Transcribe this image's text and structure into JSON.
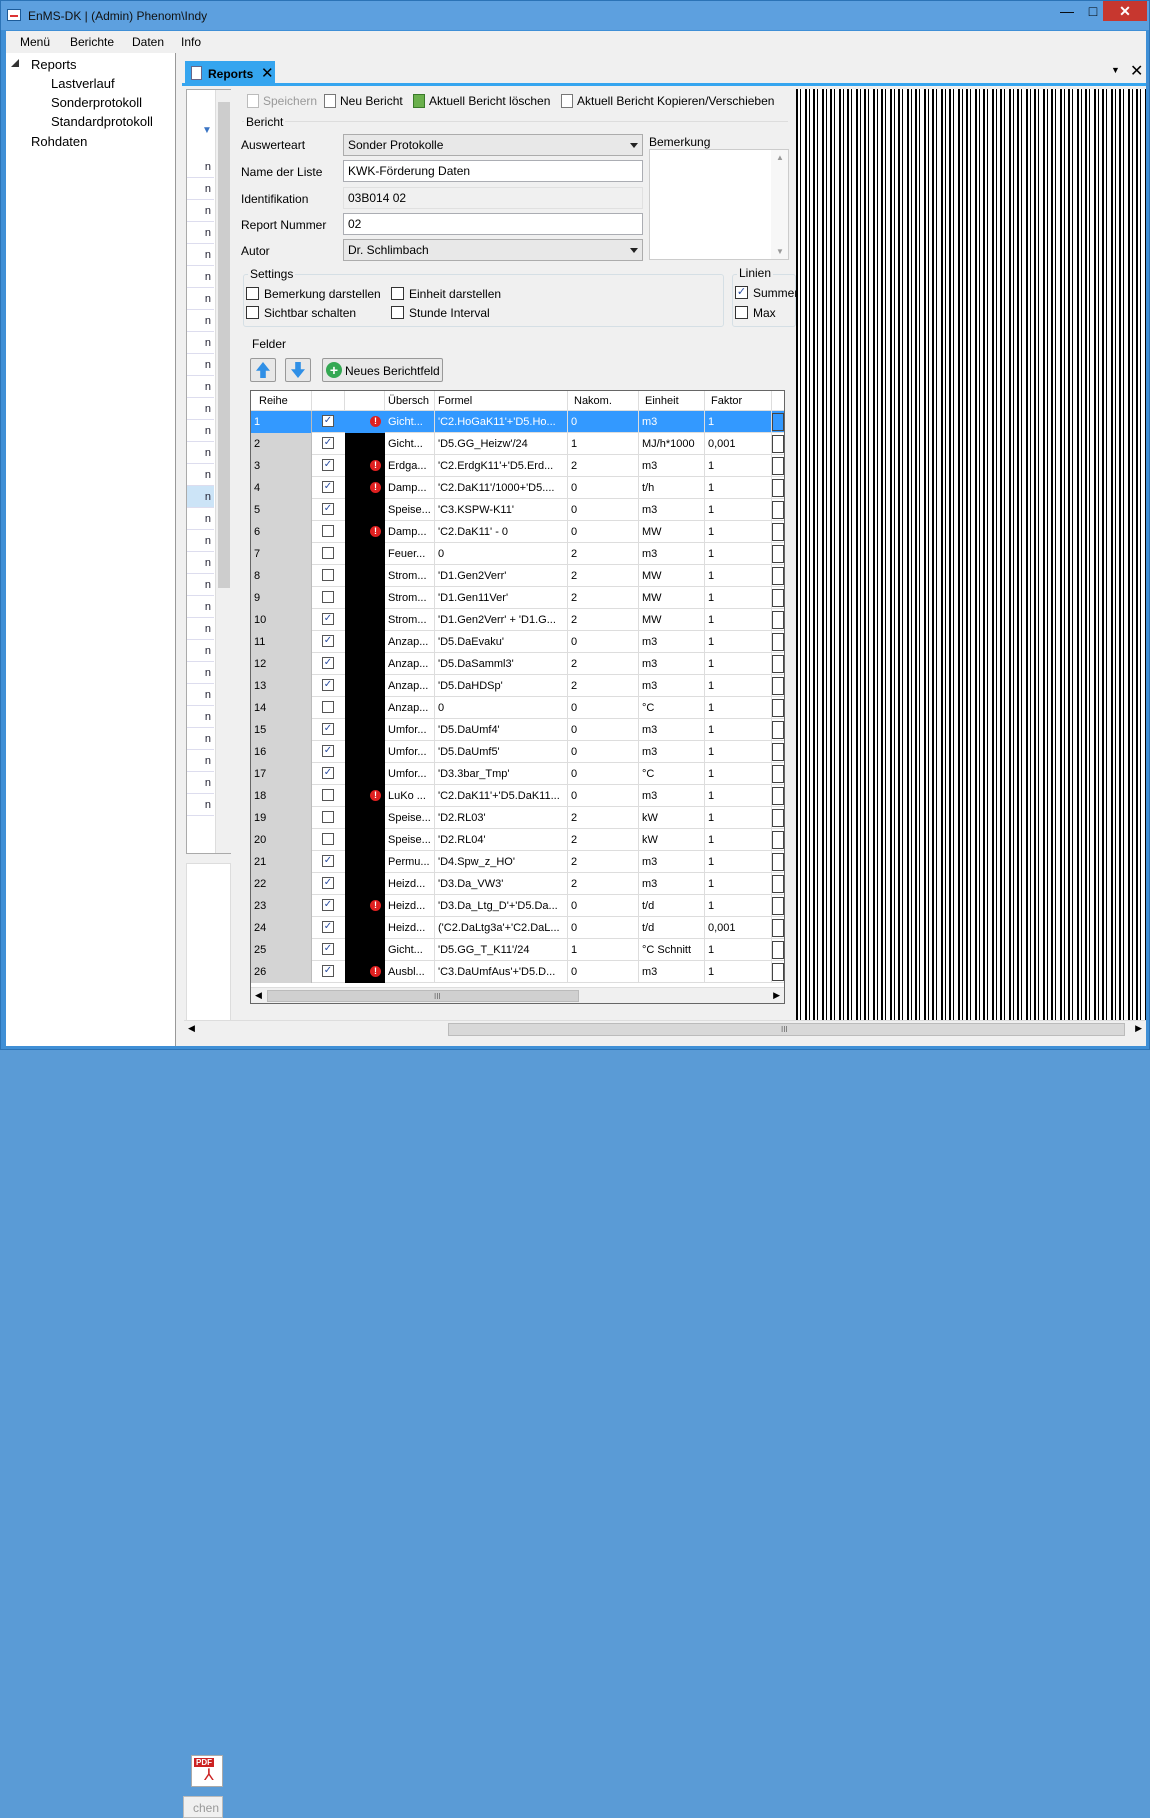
{
  "window": {
    "title": "EnMS-DK | (Admin) Phenom\\Indy",
    "minimize_glyph": "—",
    "maximize_glyph": "□",
    "close_glyph": "✕"
  },
  "menu": {
    "items": [
      "Menü",
      "Berichte",
      "Daten",
      "Info"
    ]
  },
  "tree": {
    "root": "Reports",
    "children": [
      "Lastverlauf",
      "Sonderprotokoll",
      "Standardprotokoll"
    ],
    "second": "Rohdaten"
  },
  "tabs": {
    "active": "Reports",
    "close_glyph": "✕",
    "dropdown_glyph": "▼",
    "close_all_glyph": "✕"
  },
  "leftlist": {
    "row_text": "n",
    "filter_glyph": "▼"
  },
  "leftbottom": {
    "pdf_label": "PDF",
    "pdf_symbol": "⅄",
    "search_label": "chen"
  },
  "toolbar": {
    "save": "Speichern",
    "new": "Neu Bericht",
    "delete": "Aktuell Bericht löschen",
    "copy": "Aktuell Bericht Kopieren/Verschieben"
  },
  "bericht": {
    "group_title": "Bericht",
    "auswerteart_label": "Auswerteart",
    "auswerteart_value": "Sonder Protokolle",
    "name_label": "Name der Liste",
    "name_value": "KWK-Förderung Daten",
    "ident_label": "Identifikation",
    "ident_value": "03B014 02",
    "nummer_label": "Report Nummer",
    "nummer_value": "02",
    "autor_label": "Autor",
    "autor_value": "Dr. Schlimbach",
    "bemerkung_label": "Bemerkung"
  },
  "settings": {
    "title": "Settings",
    "bemerkung_darstellen": "Bemerkung darstellen",
    "einheit_darstellen": "Einheit darstellen",
    "sichtbar_schalten": "Sichtbar schalten",
    "stunde_interval": "Stunde Interval"
  },
  "linien": {
    "title": "Linien",
    "summen": "Summen",
    "max": "Max",
    "summen_checked": true,
    "max_checked": false
  },
  "felder": {
    "title": "Felder",
    "new_field": "Neues Berichtfeld"
  },
  "grid": {
    "headers": {
      "reihe": "Reihe",
      "ueberschrift": "Übersch",
      "formel": "Formel",
      "nakom": "Nakom.",
      "einheit": "Einheit",
      "faktor": "Faktor"
    },
    "rows": [
      {
        "n": "1",
        "checked": true,
        "warn": true,
        "title": "Gicht...",
        "formel": "'C2.HoGaK11'+'D5.Ho...",
        "nakom": "0",
        "einheit": "m3",
        "faktor": "1"
      },
      {
        "n": "2",
        "checked": true,
        "warn": false,
        "title": "Gicht...",
        "formel": "'D5.GG_Heizw'/24",
        "nakom": "1",
        "einheit": "MJ/h*1000",
        "faktor": "0,001"
      },
      {
        "n": "3",
        "checked": true,
        "warn": true,
        "title": "Erdga...",
        "formel": "'C2.ErdgK11'+'D5.Erd...",
        "nakom": "2",
        "einheit": "m3",
        "faktor": "1"
      },
      {
        "n": "4",
        "checked": true,
        "warn": true,
        "title": "Damp...",
        "formel": "'C2.DaK11'/1000+'D5....",
        "nakom": "0",
        "einheit": "t/h",
        "faktor": "1"
      },
      {
        "n": "5",
        "checked": true,
        "warn": false,
        "title": "Speise...",
        "formel": "'C3.KSPW-K11'",
        "nakom": "0",
        "einheit": "m3",
        "faktor": "1"
      },
      {
        "n": "6",
        "checked": false,
        "warn": true,
        "title": "Damp...",
        "formel": "'C2.DaK11' - 0",
        "nakom": "0",
        "einheit": "MW",
        "faktor": "1"
      },
      {
        "n": "7",
        "checked": false,
        "warn": false,
        "title": "Feuer...",
        "formel": "0",
        "nakom": "2",
        "einheit": "m3",
        "faktor": "1"
      },
      {
        "n": "8",
        "checked": false,
        "warn": false,
        "title": "Strom...",
        "formel": "'D1.Gen2Verr'",
        "nakom": "2",
        "einheit": "MW",
        "faktor": "1"
      },
      {
        "n": "9",
        "checked": false,
        "warn": false,
        "title": "Strom...",
        "formel": "'D1.Gen11Ver'",
        "nakom": "2",
        "einheit": "MW",
        "faktor": "1"
      },
      {
        "n": "10",
        "checked": true,
        "warn": false,
        "title": "Strom...",
        "formel": "'D1.Gen2Verr' + 'D1.G...",
        "nakom": "2",
        "einheit": "MW",
        "faktor": "1"
      },
      {
        "n": "11",
        "checked": true,
        "warn": false,
        "title": "Anzap...",
        "formel": "'D5.DaEvaku'",
        "nakom": "0",
        "einheit": "m3",
        "faktor": "1"
      },
      {
        "n": "12",
        "checked": true,
        "warn": false,
        "title": "Anzap...",
        "formel": "'D5.DaSamml3'",
        "nakom": "2",
        "einheit": "m3",
        "faktor": "1"
      },
      {
        "n": "13",
        "checked": true,
        "warn": false,
        "title": "Anzap...",
        "formel": "'D5.DaHDSp'",
        "nakom": "2",
        "einheit": "m3",
        "faktor": "1"
      },
      {
        "n": "14",
        "checked": false,
        "warn": false,
        "title": "Anzap...",
        "formel": "0",
        "nakom": "0",
        "einheit": "°C",
        "faktor": "1"
      },
      {
        "n": "15",
        "checked": true,
        "warn": false,
        "title": "Umfor...",
        "formel": "'D5.DaUmf4'",
        "nakom": "0",
        "einheit": "m3",
        "faktor": "1"
      },
      {
        "n": "16",
        "checked": true,
        "warn": false,
        "title": "Umfor...",
        "formel": "'D5.DaUmf5'",
        "nakom": "0",
        "einheit": "m3",
        "faktor": "1"
      },
      {
        "n": "17",
        "checked": true,
        "warn": false,
        "title": "Umfor...",
        "formel": "'D3.3bar_Tmp'",
        "nakom": "0",
        "einheit": "°C",
        "faktor": "1"
      },
      {
        "n": "18",
        "checked": false,
        "warn": true,
        "title": "LuKo ...",
        "formel": "'C2.DaK11'+'D5.DaK11...",
        "nakom": "0",
        "einheit": "m3",
        "faktor": "1"
      },
      {
        "n": "19",
        "checked": false,
        "warn": false,
        "title": "Speise...",
        "formel": "'D2.RL03'",
        "nakom": "2",
        "einheit": "kW",
        "faktor": "1"
      },
      {
        "n": "20",
        "checked": false,
        "warn": false,
        "title": "Speise...",
        "formel": "'D2.RL04'",
        "nakom": "2",
        "einheit": "kW",
        "faktor": "1"
      },
      {
        "n": "21",
        "checked": true,
        "warn": false,
        "title": "Permu...",
        "formel": "'D4.Spw_z_HO'",
        "nakom": "2",
        "einheit": "m3",
        "faktor": "1"
      },
      {
        "n": "22",
        "checked": true,
        "warn": false,
        "title": "Heizd...",
        "formel": "'D3.Da_VW3'",
        "nakom": "2",
        "einheit": "m3",
        "faktor": "1"
      },
      {
        "n": "23",
        "checked": true,
        "warn": true,
        "title": "Heizd...",
        "formel": "'D3.Da_Ltg_D'+'D5.Da...",
        "nakom": "0",
        "einheit": "t/d",
        "faktor": "1"
      },
      {
        "n": "24",
        "checked": true,
        "warn": false,
        "title": "Heizd...",
        "formel": "('C2.DaLtg3a'+'C2.DaL...",
        "nakom": "0",
        "einheit": "t/d",
        "faktor": "0,001"
      },
      {
        "n": "25",
        "checked": true,
        "warn": false,
        "title": "Gicht...",
        "formel": "'D5.GG_T_K11'/24",
        "nakom": "1",
        "einheit": "°C Schnitt",
        "faktor": "1"
      },
      {
        "n": "26",
        "checked": true,
        "warn": true,
        "title": "Ausbl...",
        "formel": "'C3.DaUmfAus'+'D5.D...",
        "nakom": "0",
        "einheit": "m3",
        "faktor": "1"
      }
    ],
    "selected_row": 0
  }
}
